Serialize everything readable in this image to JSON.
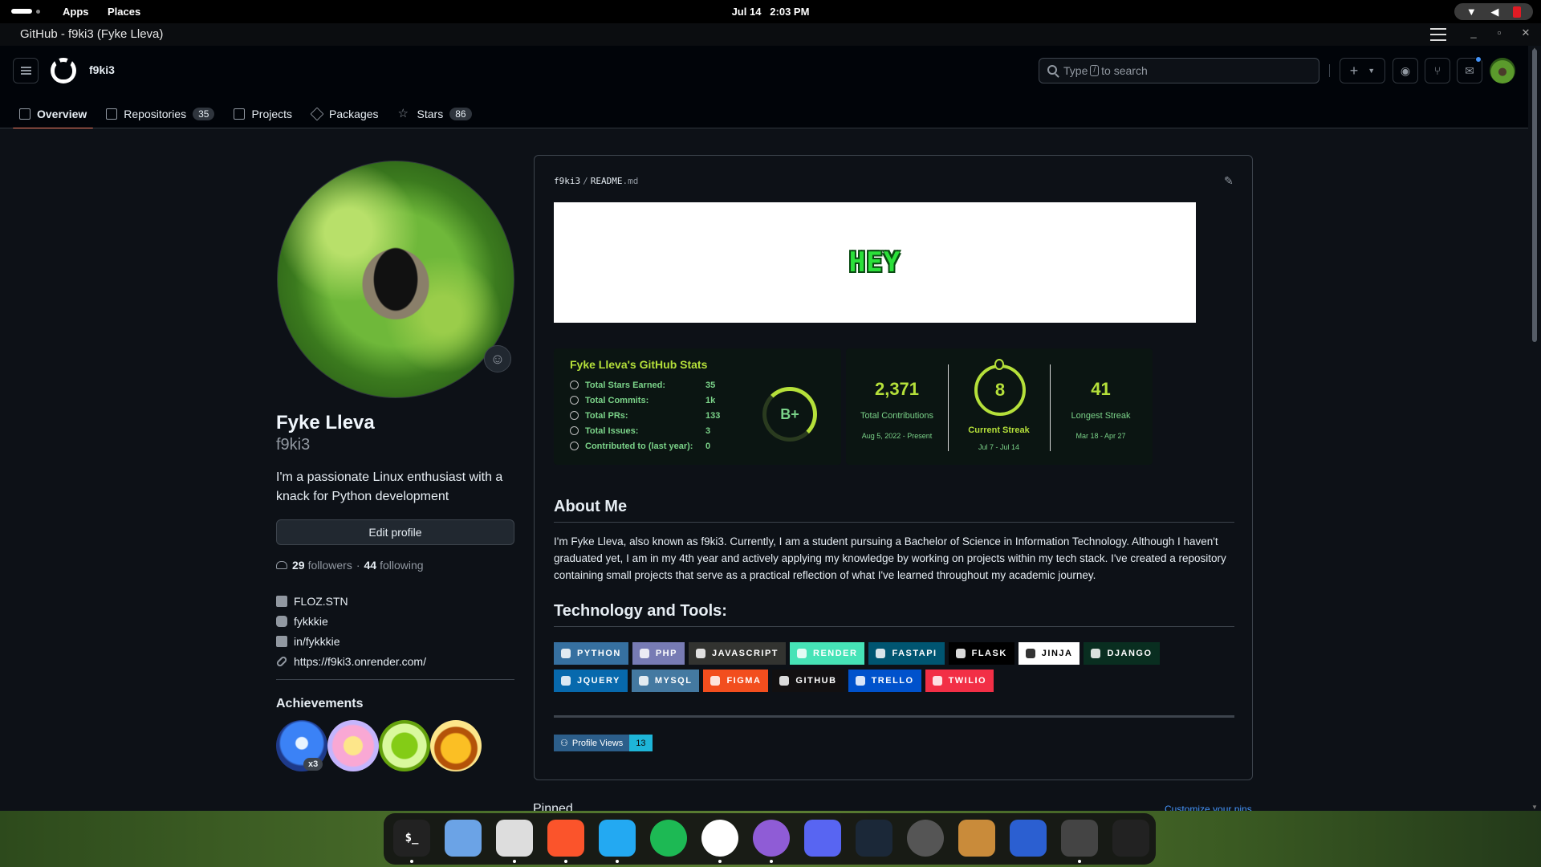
{
  "topbar": {
    "apps": "Apps",
    "places": "Places",
    "date": "Jul 14",
    "time": "2:03 PM"
  },
  "window": {
    "title": "GitHub - f9ki3 (Fyke Lleva)"
  },
  "header": {
    "username": "f9ki3",
    "search_text_before": "Type",
    "search_key": "/",
    "search_text_after": "to search"
  },
  "tabs": [
    {
      "label": "Overview",
      "active": true
    },
    {
      "label": "Repositories",
      "count": "35"
    },
    {
      "label": "Projects"
    },
    {
      "label": "Packages"
    },
    {
      "label": "Stars",
      "count": "86"
    }
  ],
  "profile": {
    "name": "Fyke Lleva",
    "login": "f9ki3",
    "bio": "I'm a passionate Linux enthusiast with a knack for Python development",
    "edit_label": "Edit profile",
    "followers_count": "29",
    "followers_label": "followers",
    "dot": "·",
    "following_count": "44",
    "following_label": "following",
    "links": [
      {
        "icon": "facebook-icon",
        "text": "FLOZ.STN"
      },
      {
        "icon": "instagram-icon",
        "text": "fykkkie"
      },
      {
        "icon": "linkedin-icon",
        "text": "in/fykkkie"
      },
      {
        "icon": "link-icon",
        "text": "https://f9ki3.onrender.com/"
      }
    ],
    "achievements_title": "Achievements",
    "achievement_multiplier": "x3"
  },
  "readme": {
    "owner": "f9ki3",
    "sep": "/",
    "file": "README",
    "ext": ".md",
    "banner_text": "HEY",
    "stats": {
      "title": "Fyke Lleva's GitHub Stats",
      "rows": [
        {
          "label": "Total Stars Earned:",
          "value": "35"
        },
        {
          "label": "Total Commits:",
          "value": "1k"
        },
        {
          "label": "Total PRs:",
          "value": "133"
        },
        {
          "label": "Total Issues:",
          "value": "3"
        },
        {
          "label": "Contributed to (last year):",
          "value": "0"
        }
      ],
      "rank": "B+"
    },
    "streak": {
      "total": "2,371",
      "total_label": "Total Contributions",
      "total_range": "Aug 5, 2022 - Present",
      "current": "8",
      "current_label": "Current Streak",
      "current_range": "Jul 7 - Jul 14",
      "longest": "41",
      "longest_label": "Longest Streak",
      "longest_range": "Mar 18 - Apr 27"
    },
    "about_title": "About Me",
    "about_text": "I'm Fyke Lleva, also known as f9ki3. Currently, I am a student pursuing a Bachelor of Science in Information Technology. Although I haven't graduated yet, I am in my 4th year and actively applying my knowledge by working on projects within my tech stack. I've created a repository containing small projects that serve as a practical reflection of what I've learned throughout my academic journey.",
    "tech_title": "Technology and Tools:",
    "tech_row1": [
      {
        "label": "PYTHON",
        "color": "#3670a0"
      },
      {
        "label": "PHP",
        "color": "#777bb4"
      },
      {
        "label": "JAVASCRIPT",
        "color": "#323330"
      },
      {
        "label": "RENDER",
        "color": "#46e3b7"
      },
      {
        "label": "FASTAPI",
        "color": "#005571"
      },
      {
        "label": "FLASK",
        "color": "#000000"
      },
      {
        "label": "JINJA",
        "color": "#ffffff"
      },
      {
        "label": "DJANGO",
        "color": "#092e20"
      }
    ],
    "tech_row2": [
      {
        "label": "JQUERY",
        "color": "#0769ad"
      },
      {
        "label": "MYSQL",
        "color": "#4479a1"
      },
      {
        "label": "FIGMA",
        "color": "#f24e1e"
      },
      {
        "label": "GITHUB",
        "color": "#121011"
      },
      {
        "label": "TRELLO",
        "color": "#0052cc"
      },
      {
        "label": "TWILIO",
        "color": "#f22f46"
      }
    ],
    "profile_views_label": "Profile Views",
    "profile_views_count": "13"
  },
  "pinned": {
    "title": "Pinned",
    "customize": "Customize your pins"
  },
  "dock": [
    {
      "icon": "terminal-icon",
      "glyph": "$_"
    },
    {
      "icon": "files-icon",
      "glyph": ""
    },
    {
      "icon": "text-editor-icon",
      "glyph": ""
    },
    {
      "icon": "brave-browser-icon",
      "glyph": ""
    },
    {
      "icon": "vscode-icon",
      "glyph": ""
    },
    {
      "icon": "spotify-icon",
      "glyph": ""
    },
    {
      "icon": "github-icon",
      "glyph": ""
    },
    {
      "icon": "github-desktop-icon",
      "glyph": ""
    },
    {
      "icon": "discord-icon",
      "glyph": ""
    },
    {
      "icon": "steam-icon",
      "glyph": ""
    },
    {
      "icon": "obs-icon",
      "glyph": ""
    },
    {
      "icon": "pixel-character-icon",
      "glyph": ""
    },
    {
      "icon": "app-icon",
      "glyph": ""
    },
    {
      "icon": "calculator-icon",
      "glyph": ""
    },
    {
      "icon": "app-grid-icon",
      "glyph": ""
    }
  ],
  "colors": {
    "accent": "#f78166",
    "link": "#4493f8",
    "stats_title": "#b5e03a",
    "stats_text": "#7bd389"
  }
}
